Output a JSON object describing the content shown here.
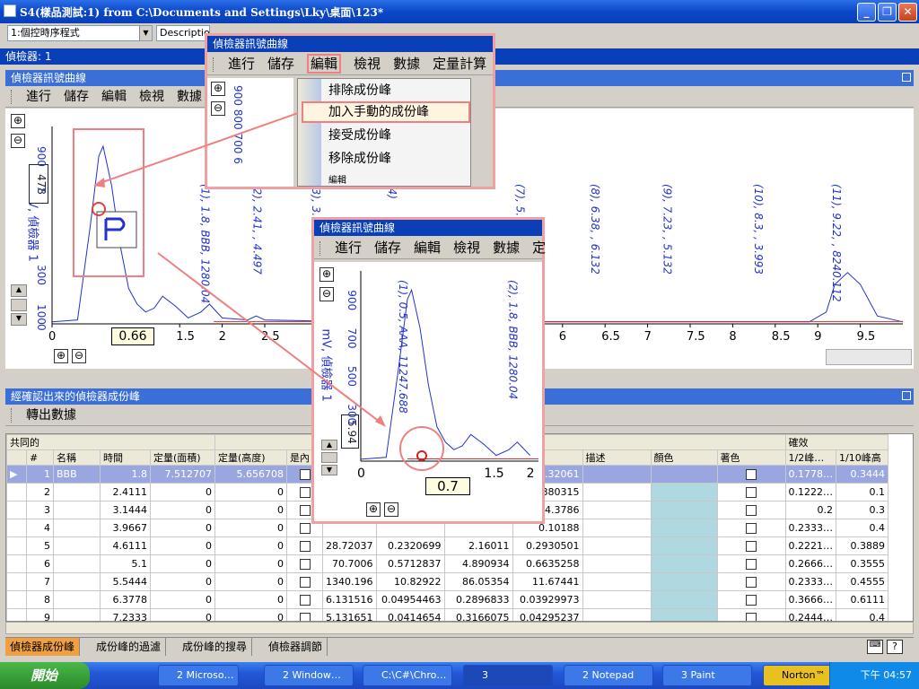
{
  "window": {
    "title": "S4(樣品測試:1) from C:\\Documents and Settings\\Lky\\桌面\\123*"
  },
  "toolbar": {
    "combo_value": "1:個控時序程式",
    "description_label": "Description"
  },
  "detector_bar": {
    "label": "偵檢器: 1"
  },
  "signal_panel": {
    "title": "偵檢器訊號曲線"
  },
  "main_menu": {
    "items": [
      "進行",
      "儲存",
      "編輯",
      "檢視",
      "數據"
    ]
  },
  "main_plot": {
    "y_axis_label": "mV, 偵檢器 1",
    "y_ticks": [
      "900",
      "7",
      "300",
      "100",
      "0"
    ],
    "y_readout": "478",
    "x_ticks": [
      "0",
      "1.5",
      "2",
      "2.5",
      "6",
      "6.5",
      "7",
      "7.5",
      "8",
      "8.5",
      "9",
      "9.5"
    ],
    "x_readout": "0.66",
    "peak_labels": [
      "(1), 1.8, BBB, 1280.04",
      "(2), 2.41, , 4.497",
      "(3), 3.",
      "(4)",
      "(7), 5.",
      "(8), 6.38, , 6.132",
      "(9), 7.23, , 5.132",
      "(10), 8.3, , 3.993",
      "(11), 9.22, , 8240.112"
    ]
  },
  "chart_data": {
    "type": "line",
    "title": "",
    "xlabel": "",
    "ylabel": "mV, 偵檢器 1",
    "series": [
      {
        "x": [
          0,
          0.3,
          0.45,
          0.55,
          0.6,
          0.7,
          0.8,
          0.9,
          1.0,
          1.1,
          1.2,
          1.3,
          1.45,
          1.6,
          1.75,
          1.85,
          2.0,
          2.3,
          2.4,
          2.5,
          3.1,
          3.2,
          3.3,
          5.0,
          8.9,
          9.1,
          9.2,
          9.35,
          9.5,
          9.7,
          10.0
        ],
        "y": [
          10,
          20,
          500,
          850,
          900,
          700,
          400,
          180,
          100,
          60,
          80,
          140,
          90,
          30,
          60,
          100,
          30,
          20,
          40,
          20,
          15,
          40,
          15,
          10,
          10,
          60,
          200,
          260,
          200,
          40,
          10
        ]
      }
    ],
    "xlim": [
      0,
      10
    ],
    "ylim": [
      0,
      1000
    ]
  },
  "edit_menu_overlay": {
    "title": "偵檢器訊號曲線",
    "menu": [
      "進行",
      "儲存",
      "編輯",
      "檢視",
      "數據",
      "定量計算"
    ],
    "items": [
      "排除成份峰",
      "加入手動的成份峰",
      "接受成份峰",
      "移除成份峰",
      "編輯"
    ],
    "y_ticks": [
      "900",
      "800",
      "700",
      "6"
    ]
  },
  "zoom_overlay": {
    "title": "偵檢器訊號曲線",
    "menu": [
      "進行",
      "儲存",
      "編輯",
      "檢視",
      "數據",
      "定"
    ],
    "y_axis_label": "mV, 偵檢器 1",
    "y_ticks": [
      "900",
      "700",
      "500",
      "300"
    ],
    "y_readout": "5.94",
    "x_ticks": [
      "0",
      "1.5",
      "2"
    ],
    "x_readout": "0.7",
    "peak_labels": [
      "(1), 0.5, AAA, 11247.688",
      "(2), 1.8, BBB, 1280.04"
    ]
  },
  "peaks_panel": {
    "title": "經確認出來的偵檢器成份峰",
    "export_label": "轉出數據"
  },
  "grid": {
    "group_header_left": "共同的",
    "group_header_right": "確效",
    "columns": [
      "#",
      "名稱",
      "時間",
      "定量(面積)",
      "定量(高度)",
      "是內",
      "",
      "",
      "",
      "高度%",
      "描述",
      "顏色",
      "著色",
      "1/2峰…",
      "1/10峰高"
    ],
    "rows": [
      [
        "1",
        "BBB",
        "1.8",
        "7.512707",
        "5.656708",
        "",
        "",
        "",
        "",
        "14.32061",
        "",
        "",
        "",
        "0.1778…",
        "0.3444"
      ],
      [
        "2",
        "",
        "2.4111",
        "0",
        "0",
        "",
        "",
        "",
        "",
        "0.02880315",
        "",
        "",
        "",
        "0.1222…",
        "0.1"
      ],
      [
        "3",
        "",
        "3.1444",
        "0",
        "0",
        "",
        "",
        "",
        "",
        "14.3786",
        "",
        "",
        "",
        "0.2",
        "0.3"
      ],
      [
        "4",
        "",
        "3.9667",
        "0",
        "0",
        "",
        "",
        "",
        "",
        "0.10188",
        "",
        "",
        "",
        "0.2333…",
        "0.4"
      ],
      [
        "5",
        "",
        "4.6111",
        "0",
        "0",
        "",
        "28.72037",
        "0.2320699",
        "2.16011",
        "0.2930501",
        "",
        "",
        "",
        "0.2221…",
        "0.3889"
      ],
      [
        "6",
        "",
        "5.1",
        "0",
        "0",
        "",
        "70.7006",
        "0.5712837",
        "4.890934",
        "0.6635258",
        "",
        "",
        "",
        "0.2666…",
        "0.3555"
      ],
      [
        "7",
        "",
        "5.5444",
        "0",
        "0",
        "",
        "1340.196",
        "10.82922",
        "86.05354",
        "11.67441",
        "",
        "",
        "",
        "0.2333…",
        "0.4555"
      ],
      [
        "8",
        "",
        "6.3778",
        "0",
        "0",
        "",
        "6.131516",
        "0.04954463",
        "0.2896833",
        "0.03929973",
        "",
        "",
        "",
        "0.3666…",
        "0.6111"
      ],
      [
        "9",
        "",
        "7.2333",
        "0",
        "0",
        "",
        "5.131651",
        "0.0414654",
        "0.3166075",
        "0.04295237",
        "",
        "",
        "",
        "0.2444…",
        "0.4"
      ]
    ]
  },
  "bottom_tabs": [
    "偵檢器成份峰",
    "成份峰的過濾",
    "成份峰的搜尋",
    "偵檢器調節"
  ],
  "taskbar": {
    "start_label": "開始",
    "buttons": [
      "2 Microso…",
      "2 Window…",
      "C:\\C#\\Chro…",
      "3",
      "2 Notepad",
      "3 Paint",
      "Norton™"
    ],
    "clock": "下午 04:57"
  }
}
